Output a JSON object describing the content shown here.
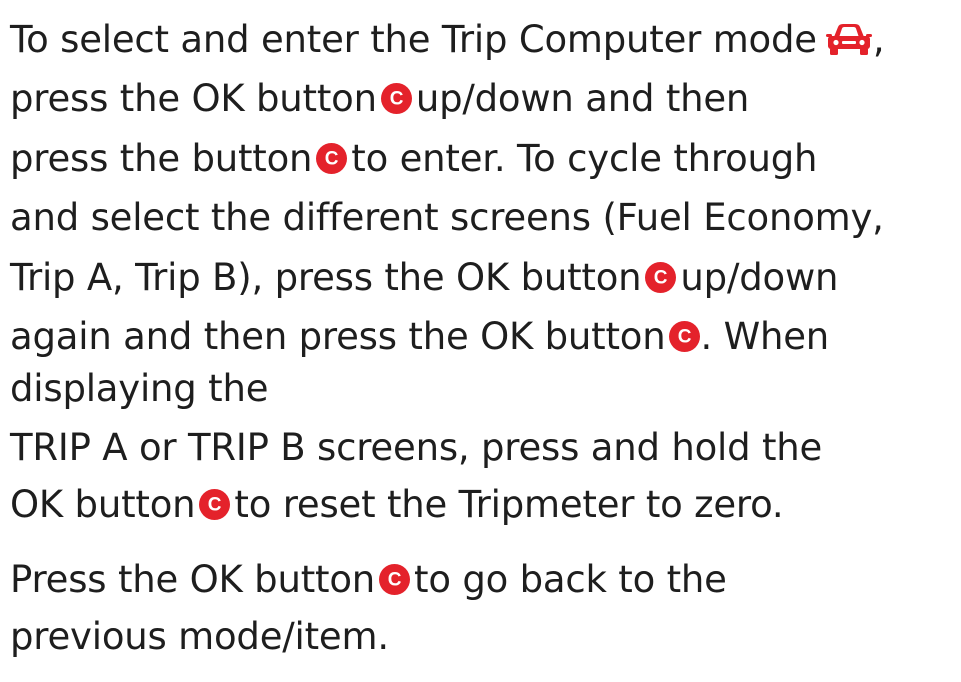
{
  "colors": {
    "text": "#1e1e1e",
    "accent": "#e4222b"
  },
  "icons": {
    "ok_button": "ok-button-c-icon",
    "trip_computer": "car-icon"
  },
  "ok_badge_letter": "C",
  "paragraph1": {
    "l1_a": "To select and enter the Trip Computer mode",
    "l1_b": ",",
    "l2_a": "press the OK button",
    "l2_b": "up/down and then",
    "l3_a": "press the button",
    "l3_b": "to enter. To cycle through",
    "l4": "and select the different screens (Fuel Economy,",
    "l5_a": "Trip A, Trip B), press the OK button",
    "l5_b": "up/down",
    "l6_a": "again and then press the OK button",
    "l6_b": ". When",
    "l7": "displaying the",
    "l8": "TRIP A or TRIP B screens, press and hold the",
    "l9_a": "OK button",
    "l9_b": "to reset the Tripmeter to zero."
  },
  "paragraph2": {
    "l1_a": "Press the OK button",
    "l1_b": "to go back to the",
    "l2": "previous mode/item."
  }
}
